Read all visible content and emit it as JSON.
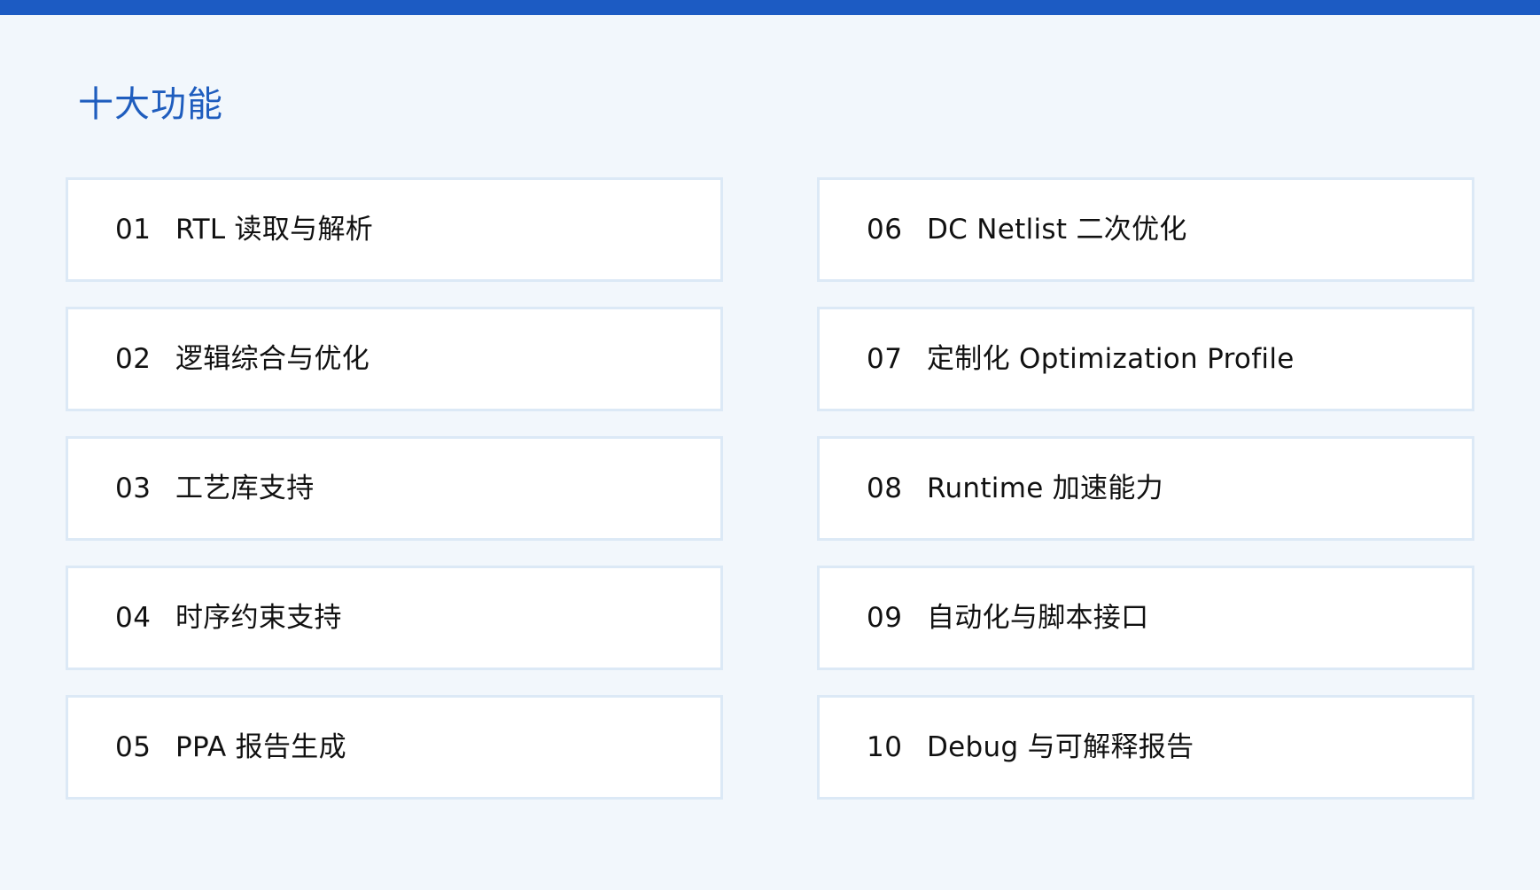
{
  "page": {
    "title": "十大功能"
  },
  "features": [
    {
      "num": "01",
      "label": "RTL 读取与解析"
    },
    {
      "num": "06",
      "label": "DC Netlist 二次优化"
    },
    {
      "num": "02",
      "label": "逻辑综合与优化"
    },
    {
      "num": "07",
      "label": "定制化 Optimization Profile"
    },
    {
      "num": "03",
      "label": "工艺库支持"
    },
    {
      "num": "08",
      "label": "Runtime 加速能力"
    },
    {
      "num": "04",
      "label": "时序约束支持"
    },
    {
      "num": "09",
      "label": "自动化与脚本接口"
    },
    {
      "num": "05",
      "label": "PPA 报告生成"
    },
    {
      "num": "10",
      "label": "Debug 与可解释报告"
    }
  ],
  "colors": {
    "accent": "#1c5bc3",
    "title": "#1f5dbe",
    "background": "#f2f7fc",
    "card_border": "#dce9f6",
    "card_background": "#ffffff",
    "text": "#111111"
  }
}
